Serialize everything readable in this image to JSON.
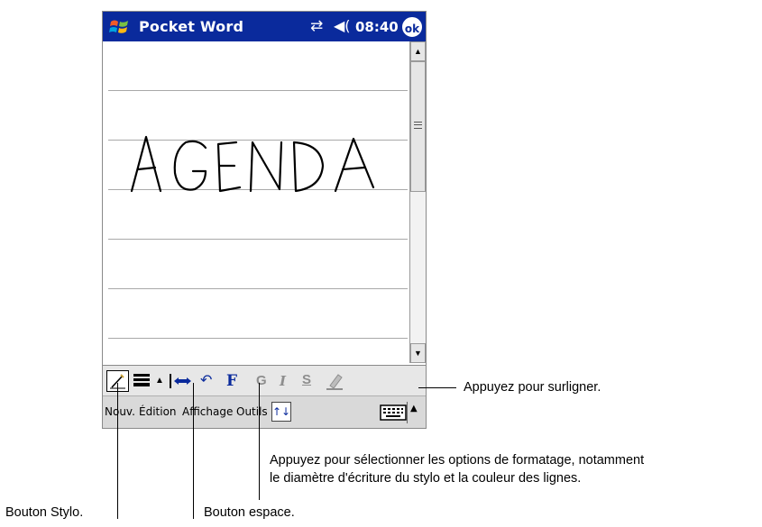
{
  "titlebar": {
    "app_title": "Pocket Word",
    "clock": "08:40",
    "ok_label": "ok",
    "icons": [
      "windows-flag-icon",
      "connectivity-icon",
      "speaker-icon"
    ]
  },
  "document": {
    "handwriting": "AGENDA"
  },
  "pen_toolbar": {
    "tools": [
      "pen-icon",
      "line-thickness-icon",
      "up-arrow-icon",
      "space-icon",
      "undo-icon",
      "format-icon",
      "bold-icon",
      "italic-icon",
      "underline-icon",
      "highlighter-icon"
    ],
    "bold_glyph": "G",
    "italic_glyph": "I",
    "underline_glyph": "S",
    "format_glyph": "F"
  },
  "menubar": {
    "items": [
      "Nouv.",
      "Édition",
      "Affichage",
      "Outils"
    ]
  },
  "callouts": {
    "highlight": "Appuyez pour surligner.",
    "format_line1": "Appuyez pour sélectionner les options de formatage, notamment",
    "format_line2": "le diamètre d'écriture du stylo et la couleur des lignes.",
    "pen": "Bouton Stylo.",
    "space": "Bouton espace."
  },
  "colors": {
    "titlebar": "#0a2a9c",
    "toolbar": "#e7e7e7",
    "menubar": "#d9d9d9"
  }
}
